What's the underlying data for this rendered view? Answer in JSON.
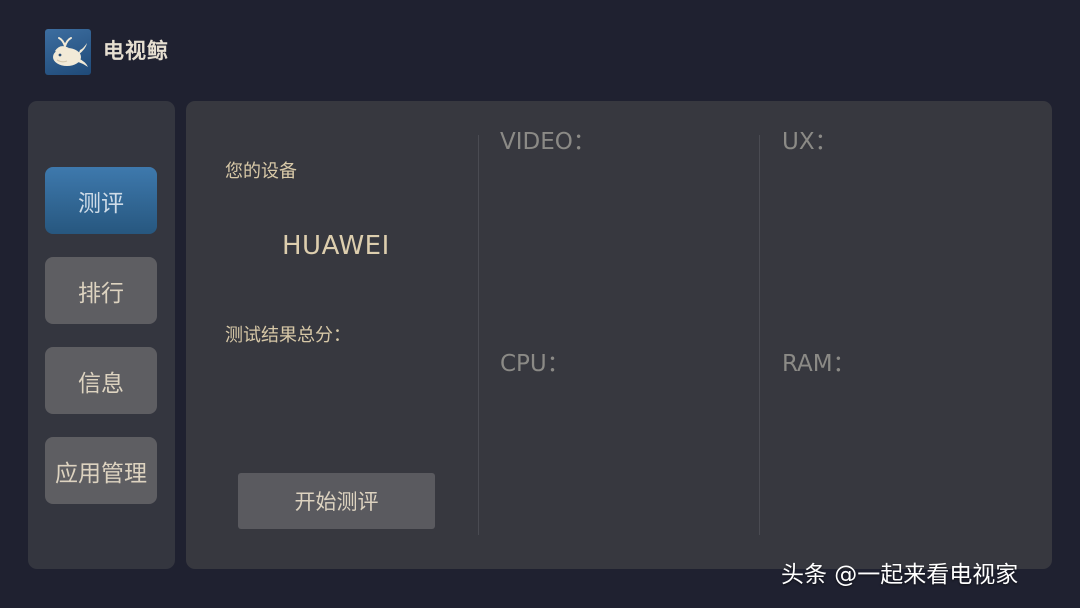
{
  "app": {
    "title": "电视鲸",
    "logo_icon": "whale-logo-icon"
  },
  "sidebar": {
    "items": [
      {
        "label": "测评",
        "active": true
      },
      {
        "label": "排行",
        "active": false
      },
      {
        "label": "信息",
        "active": false
      },
      {
        "label": "应用管理",
        "active": false
      }
    ]
  },
  "main": {
    "device_label": "您的设备",
    "device_name": "HUAWEI",
    "total_score_label": "测试结果总分：",
    "start_button_label": "开始测评",
    "metrics": {
      "video": "VIDEO：",
      "ux": "UX：",
      "cpu": "CPU：",
      "ram": "RAM："
    }
  },
  "watermark": "头条 @一起来看电视家",
  "colors": {
    "background": "#1f2130",
    "panel": "#37383f",
    "active_accent": "#3e79ad",
    "text_gold": "#d7c8a7"
  }
}
